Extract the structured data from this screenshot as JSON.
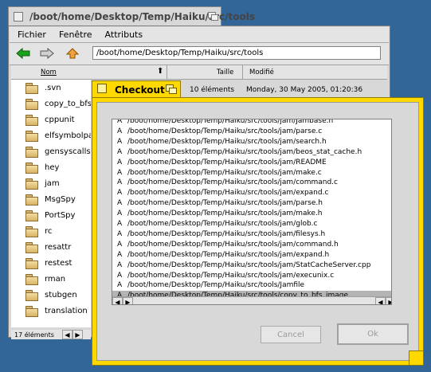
{
  "tracker": {
    "title": "/boot/home/Desktop/Temp/Haiku/src/tools",
    "menu": [
      "Fichier",
      "Fenêtre",
      "Attributs"
    ],
    "path": "/boot/home/Desktop/Temp/Haiku/src/tools",
    "columns": {
      "name": "Nom",
      "size": "Taille",
      "modified": "Modifié"
    },
    "first_row": {
      "size": "10 éléments",
      "modified": "Monday, 30 May 2005, 01:20:36"
    },
    "files": [
      ".svn",
      "copy_to_bfs_image",
      "cppunit",
      "elfsymbolpatcher",
      "gensyscalls",
      "hey",
      "jam",
      "MsgSpy",
      "PortSpy",
      "rc",
      "resattr",
      "restest",
      "rman",
      "stubgen",
      "translation"
    ],
    "status": "17 éléments",
    "colors": {
      "desktop": "#336698",
      "window": "#d8d8d8"
    }
  },
  "checkout": {
    "title": "Checkout",
    "rows": [
      {
        "s": "A",
        "p": "/boot/home/Desktop/Temp/Haiku/src/tools/jam/Jambase.h"
      },
      {
        "s": "A",
        "p": "/boot/home/Desktop/Temp/Haiku/src/tools/jam/parse.c"
      },
      {
        "s": "A",
        "p": "/boot/home/Desktop/Temp/Haiku/src/tools/jam/search.h"
      },
      {
        "s": "A",
        "p": "/boot/home/Desktop/Temp/Haiku/src/tools/jam/beos_stat_cache.h"
      },
      {
        "s": "A",
        "p": "/boot/home/Desktop/Temp/Haiku/src/tools/jam/README"
      },
      {
        "s": "A",
        "p": "/boot/home/Desktop/Temp/Haiku/src/tools/jam/make.c"
      },
      {
        "s": "A",
        "p": "/boot/home/Desktop/Temp/Haiku/src/tools/jam/command.c"
      },
      {
        "s": "A",
        "p": "/boot/home/Desktop/Temp/Haiku/src/tools/jam/expand.c"
      },
      {
        "s": "A",
        "p": "/boot/home/Desktop/Temp/Haiku/src/tools/jam/parse.h"
      },
      {
        "s": "A",
        "p": "/boot/home/Desktop/Temp/Haiku/src/tools/jam/make.h"
      },
      {
        "s": "A",
        "p": "/boot/home/Desktop/Temp/Haiku/src/tools/jam/glob.c"
      },
      {
        "s": "A",
        "p": "/boot/home/Desktop/Temp/Haiku/src/tools/jam/filesys.h"
      },
      {
        "s": "A",
        "p": "/boot/home/Desktop/Temp/Haiku/src/tools/jam/command.h"
      },
      {
        "s": "A",
        "p": "/boot/home/Desktop/Temp/Haiku/src/tools/jam/expand.h"
      },
      {
        "s": "A",
        "p": "/boot/home/Desktop/Temp/Haiku/src/tools/jam/StatCacheServer.cpp"
      },
      {
        "s": "A",
        "p": "/boot/home/Desktop/Temp/Haiku/src/tools/jam/execunix.c"
      },
      {
        "s": "A",
        "p": "/boot/home/Desktop/Temp/Haiku/src/tools/Jamfile"
      },
      {
        "s": "A",
        "p": "/boot/home/Desktop/Temp/Haiku/src/tools/copy_to_bfs_image"
      }
    ],
    "selected_index": 17,
    "cancel_label": "Cancel",
    "ok_label": "Ok",
    "colors": {
      "tab": "#ffd800"
    }
  }
}
